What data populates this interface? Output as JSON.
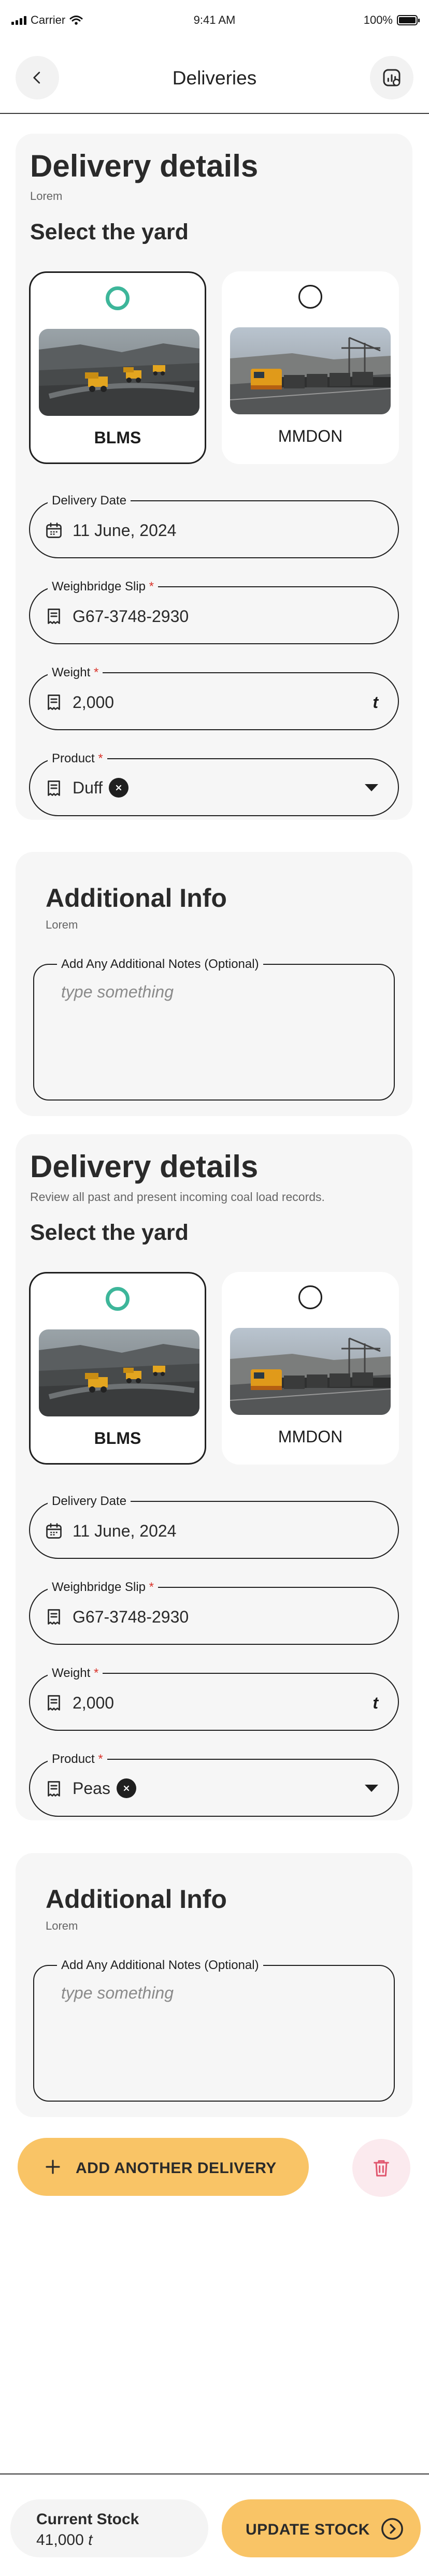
{
  "status_bar": {
    "carrier": "Carrier",
    "time": "9:41 AM",
    "battery": "100%"
  },
  "header": {
    "title": "Deliveries",
    "back_icon": "chevron-left-icon",
    "report_icon": "chart-report-icon"
  },
  "deliveries": [
    {
      "title": "Delivery details",
      "subtitle": "Lorem",
      "yard_heading": "Select the yard",
      "yards": [
        {
          "name": "BLMS",
          "selected": true,
          "image": "mining-trucks-pit"
        },
        {
          "name": "MMDON",
          "selected": false,
          "image": "coal-train-loader"
        }
      ],
      "date": {
        "label": "Delivery Date",
        "value": "11 June, 2024"
      },
      "slip": {
        "label": "Weighbridge Slip",
        "required_mark": "*",
        "value": "G67-3748-2930"
      },
      "weight": {
        "label": "Weight",
        "required_mark": "*",
        "value": "2,000",
        "unit": "t"
      },
      "product": {
        "label": "Product",
        "required_mark": "*",
        "value": "Duff"
      },
      "info": {
        "title": "Additional Info",
        "subtitle": "Lorem",
        "notes_label": "Add Any Additional Notes (Optional)",
        "notes_placeholder": "type something"
      }
    },
    {
      "title": "Delivery details",
      "subtitle": "Review all past and present incoming coal load records.",
      "yard_heading": "Select the yard",
      "yards": [
        {
          "name": "BLMS",
          "selected": true,
          "image": "mining-trucks-pit"
        },
        {
          "name": "MMDON",
          "selected": false,
          "image": "coal-train-loader"
        }
      ],
      "date": {
        "label": "Delivery Date",
        "value": "11 June, 2024"
      },
      "slip": {
        "label": "Weighbridge Slip",
        "required_mark": "*",
        "value": "G67-3748-2930"
      },
      "weight": {
        "label": "Weight",
        "required_mark": "*",
        "value": "2,000",
        "unit": "t"
      },
      "product": {
        "label": "Product",
        "required_mark": "*",
        "value": "Peas"
      },
      "info": {
        "title": "Additional Info",
        "subtitle": "Lorem",
        "notes_label": "Add Any Additional Notes (Optional)",
        "notes_placeholder": "type something"
      }
    }
  ],
  "add_button": {
    "label": "ADD ANOTHER DELIVERY",
    "icon": "plus-icon"
  },
  "delete_button": {
    "icon": "trash-icon"
  },
  "footer": {
    "stock_label": "Current Stock",
    "stock_value": "41,000",
    "stock_unit": "t",
    "update_label": "UPDATE STOCK",
    "update_icon": "arrow-right-circle-icon"
  },
  "colors": {
    "accent": "#f9c466",
    "radio_selected": "#3db69a",
    "required": "#d9342b",
    "delete_bg": "#fbeaee",
    "delete_icon": "#e0566e"
  }
}
